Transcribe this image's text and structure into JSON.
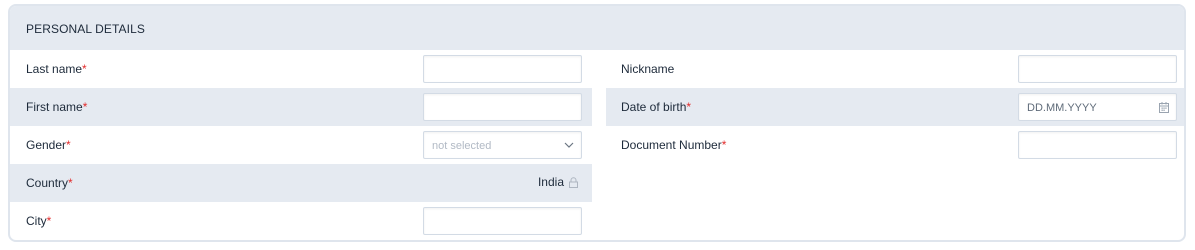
{
  "section": {
    "title": "PERSONAL DETAILS"
  },
  "required_mark": "*",
  "fields": {
    "last_name": {
      "label": "Last name",
      "value": ""
    },
    "first_name": {
      "label": "First name",
      "value": ""
    },
    "gender": {
      "label": "Gender",
      "selected": "not selected"
    },
    "country": {
      "label": "Country",
      "value": "India"
    },
    "city": {
      "label": "City",
      "value": ""
    },
    "nickname": {
      "label": "Nickname",
      "value": ""
    },
    "date_of_birth": {
      "label": "Date of birth",
      "placeholder": "DD.MM.YYYY"
    },
    "document_number": {
      "label": "Document Number",
      "value": ""
    }
  },
  "icons": {
    "gender_dropdown": "chevron-down-icon",
    "date_picker": "calendar-icon",
    "country_lock": "lock-icon"
  },
  "colors": {
    "header_bg": "#e5eaf1",
    "required": "#e22b2b",
    "border": "#d3dbe5"
  }
}
